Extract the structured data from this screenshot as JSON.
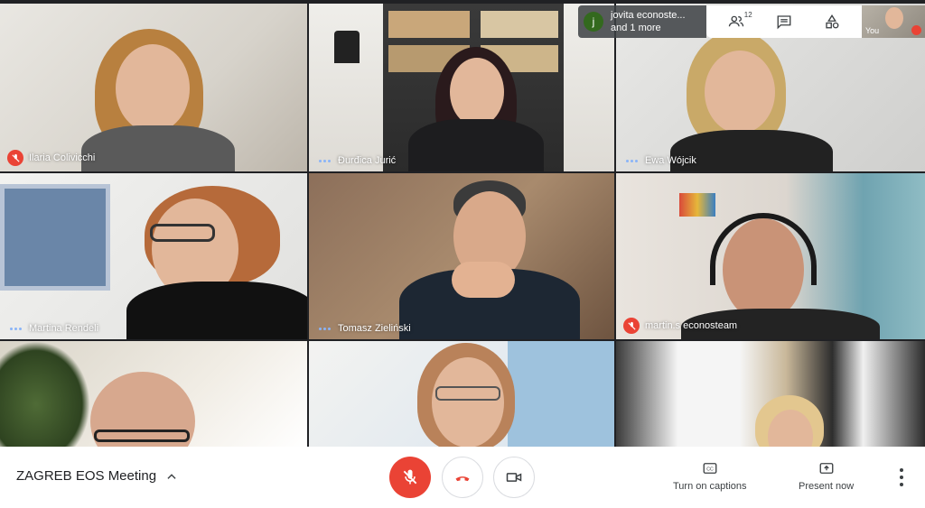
{
  "participants": [
    {
      "name": "Ilaria Colivicchi",
      "status": "muted"
    },
    {
      "name": "Đurđica Jurić",
      "status": "speaking"
    },
    {
      "name": "Ewa Wójcik",
      "status": "speaking"
    },
    {
      "name": "Martina Rendeli",
      "status": "speaking"
    },
    {
      "name": "Tomasz Zieliński",
      "status": "speaking"
    },
    {
      "name": "martin.s econosteam",
      "status": "muted"
    }
  ],
  "chat_popup": {
    "avatar_letter": "j",
    "line1": "jovita econoste...",
    "line2": "and 1 more"
  },
  "top_bar": {
    "people_count": "12",
    "icons": [
      "people-icon",
      "chat-icon",
      "activities-icon"
    ]
  },
  "self_view": {
    "label": "You"
  },
  "meeting": {
    "title": "ZAGREB EOS Meeting"
  },
  "actions": {
    "captions": "Turn on captions",
    "present": "Present now"
  },
  "colors": {
    "mute_red": "#ea4335",
    "speaking_blue": "#8ab4f8",
    "dark_bg": "#202124"
  }
}
